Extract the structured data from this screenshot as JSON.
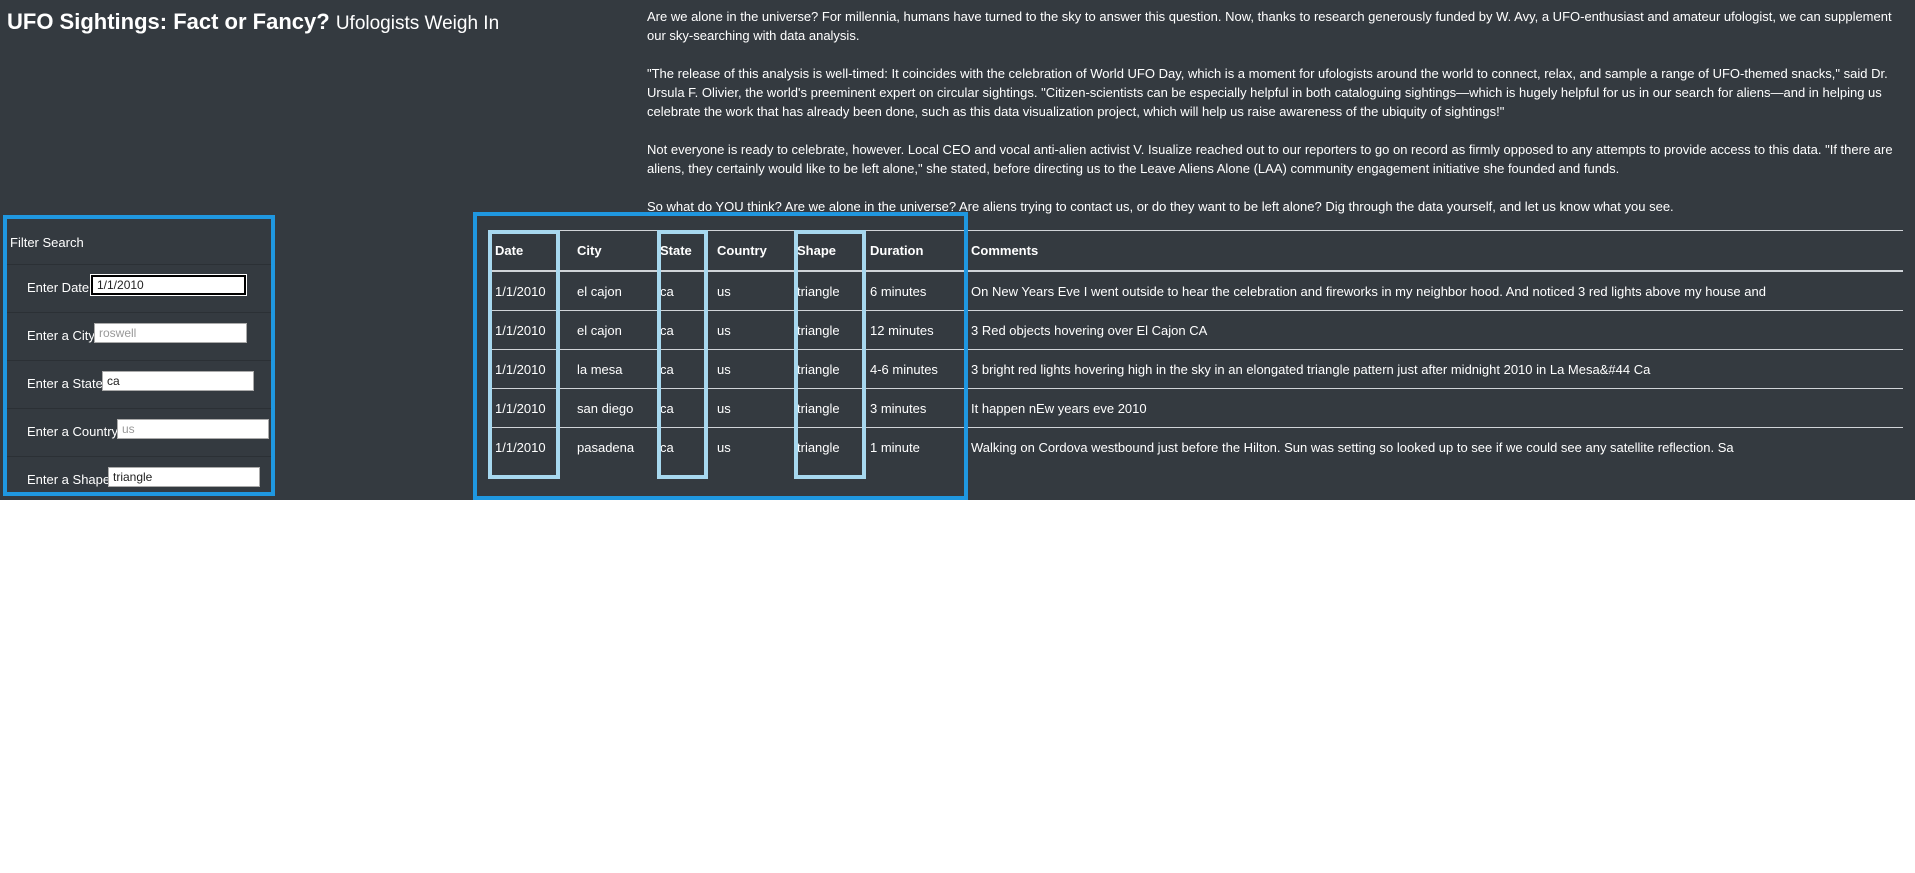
{
  "header": {
    "title": "UFO Sightings: Fact or Fancy?",
    "subtitle": "Ufologists Weigh In"
  },
  "article": {
    "paragraphs": [
      "Are we alone in the universe? For millennia, humans have turned to the sky to answer this question. Now, thanks to research generously funded by W. Avy, a UFO-enthusiast and amateur ufologist, we can supplement our sky-searching with data analysis.",
      "\"The release of this analysis is well-timed: It coincides with the celebration of World UFO Day, which is a moment for ufologists around the world to connect, relax, and sample a range of UFO-themed snacks,\" said Dr. Ursula F. Olivier, the world's preeminent expert on circular sightings. \"Citizen-scientists can be especially helpful in both cataloguing sightings—which is hugely helpful for us in our search for aliens—and in helping us celebrate the work that has already been done, such as this data visualization project, which will help us raise awareness of the ubiquity of sightings!\"",
      "Not everyone is ready to celebrate, however. Local CEO and vocal anti-alien activist V. Isualize reached out to our reporters to go on record as firmly opposed to any attempts to provide access to this data. \"If there are aliens, they certainly would like to be left alone,\" she stated, before directing us to the Leave Aliens Alone (LAA) community engagement initiative she founded and funds.",
      "So what do YOU think? Are we alone in the universe? Are aliens trying to contact us, or do they want to be left alone? Dig through the data yourself, and let us know what you see."
    ]
  },
  "filters": {
    "heading": "Filter Search",
    "fields": [
      {
        "label": "Enter Date",
        "value": "1/1/2010",
        "placeholder": ""
      },
      {
        "label": "Enter a City",
        "value": "",
        "placeholder": "roswell"
      },
      {
        "label": "Enter a State",
        "value": "ca",
        "placeholder": ""
      },
      {
        "label": "Enter a Country",
        "value": "",
        "placeholder": "us"
      },
      {
        "label": "Enter a Shape",
        "value": "triangle",
        "placeholder": ""
      }
    ]
  },
  "table": {
    "headers": [
      "Date",
      "City",
      "State",
      "Country",
      "Shape",
      "Duration",
      "Comments"
    ],
    "rows": [
      [
        "1/1/2010",
        "el cajon",
        "ca",
        "us",
        "triangle",
        "6 minutes",
        "On New Years Eve I went outside to hear the celebration and fireworks in my neighbor hood. And noticed 3 red lights above my house and"
      ],
      [
        "1/1/2010",
        "el cajon",
        "ca",
        "us",
        "triangle",
        "12 minutes",
        "3 Red objects hovering over El Cajon CA"
      ],
      [
        "1/1/2010",
        "la mesa",
        "ca",
        "us",
        "triangle",
        "4-6 minutes",
        "3 bright red lights hovering high in the sky in an elongated triangle pattern just after midnight 2010 in La Mesa&#44 Ca"
      ],
      [
        "1/1/2010",
        "san diego",
        "ca",
        "us",
        "triangle",
        "3 minutes",
        "It happen nEw years eve 2010"
      ],
      [
        "1/1/2010",
        "pasadena",
        "ca",
        "us",
        "triangle",
        "1 minute",
        "Walking on Cordova westbound just before the Hilton. Sun was setting so looked up to see if we could see any satellite reflection. Sa"
      ]
    ]
  },
  "colors": {
    "background": "#343a40",
    "highlight_frame": "#1f97e0",
    "column_highlight": "#a7d8ef"
  }
}
